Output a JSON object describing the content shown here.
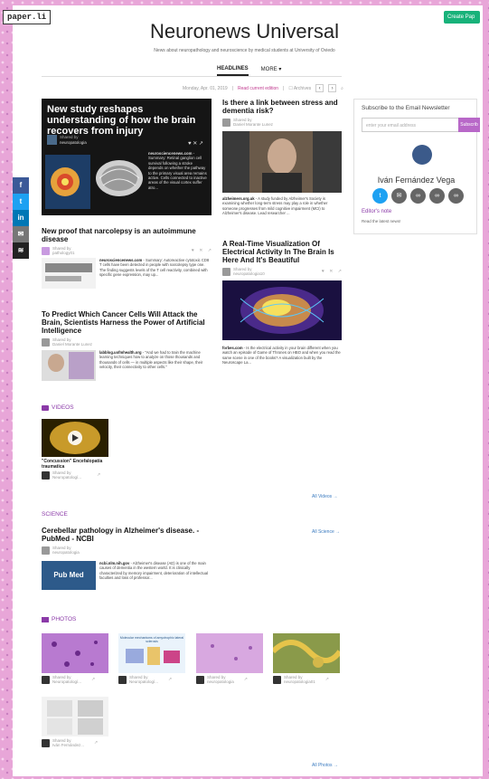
{
  "header": {
    "logo": "paper.li",
    "create_button": "Create Pap",
    "title": "Neuronews Universal",
    "subtitle": "News about neuropathology and neuroscience by medical students at University of Oviedo"
  },
  "nav": {
    "tabs": [
      "HEADLINES",
      "MORE ▾"
    ]
  },
  "datebar": {
    "date": "Monday, Apr. 01, 2019",
    "current": "Read current edition",
    "archives": "☐ Archives",
    "prev": "‹",
    "next": "›",
    "search": "⌕"
  },
  "share_icons": [
    "f",
    "t",
    "in",
    "✉",
    "≋"
  ],
  "share_colors": [
    "#3b5998",
    "#1da1f2",
    "#0077b5",
    "#777777",
    "#222222"
  ],
  "hero": {
    "title": "New study reshapes understanding of how the brain recovers from injury",
    "shared": "Shared by",
    "author": "neuropatologia",
    "excerpt_source": "neurosciencenews.com",
    "excerpt": "- Summary: Retinal ganglion cell survival following a stroke depends on whether the pathway to the primary visual area remains active. Cells connected to inactive areas of the visual cortex suffer atro..."
  },
  "a1": {
    "title": "Is there a link between stress and dementia risk?",
    "shared": "Shared by",
    "author": "Daniel Morante Lunez",
    "source": "alzheimers.org.uk",
    "excerpt": "- A study funded by Alzheimer's Society is examining whether long-term stress may play a role in whether someone progresses from mild cognitive impairment (MCI) to Alzheimer's disease. Lead researcher ..."
  },
  "a2": {
    "title": "New proof that narcolepsy is an autoimmune disease",
    "shared": "Shared by",
    "author": "pathology01",
    "source": "neurosciencenews.com",
    "excerpt": "- Summary: Autoreactive cytotoxic CD8 T cells have been detected in people with narcolepsy type one. The finding suggests levels of the T cell reactivity, combined with specific gene expression, may up..."
  },
  "a3": {
    "title": "A Real-Time Visualization Of Electrical Activity In The Brain Is Here And It's Beautiful",
    "shared": "Shared by",
    "author": "neuropatologia10",
    "source": "forbes.com",
    "excerpt": "- Is the electrical activity in your brain different when you watch an episode of Game of Thrones on HBO and when you read the same scene in one of the books? A visualization built by the Neuroscape La..."
  },
  "a4": {
    "title": "To Predict Which Cancer Cells Will Attack the Brain, Scientists Harness the Power of Artificial Intelligence",
    "shared": "Shared by",
    "author": "Daniel Morante Lunez",
    "source": "labblog.uofmhealth.org",
    "excerpt": "- \"And we had to train the machine learning techniques how to analyze on those thousands and thousands of cells — in multiple aspects like their shape, their velocity, their connectivity to other cells.\""
  },
  "sidebar": {
    "heading": "Subscribe to the Email Newsletter",
    "placeholder": "enter your email address",
    "button": "Subscrib",
    "name": "Iván Fernández Vega",
    "note_title": "Editor's note",
    "note": "Read the latest news!",
    "icon_colors": [
      "#1da1f2",
      "#666666",
      "#666666",
      "#666666",
      "#666666"
    ]
  },
  "videos": {
    "label": "VIDEOS",
    "item_title": "\"Concussion\" Encefalopatía traumatica",
    "shared": "Shared by",
    "author": "Neuropatologí...",
    "more": "All Videos →"
  },
  "science": {
    "label": "SCIENCE",
    "more": "All Science →",
    "title": "Cerebellar pathology in Alzheimer's disease. - PubMed - NCBI",
    "shared": "Shared by",
    "author": "neuropatologia",
    "source": "ncbi.nlm.nih.gov",
    "excerpt": "- Alzheimer's disease (AD) is one of the main causes of dementia in the western world. It is clinically characterized by memory impairment, deterioration of intellectual faculties and loss of professor...",
    "pubmed": "Pub Med"
  },
  "photos": {
    "label": "PHOTOS",
    "more": "All Photos →",
    "items": [
      {
        "shared": "Shared by",
        "author": "Neuropatologí..."
      },
      {
        "shared": "Shared by",
        "author": "Neuropatologí..."
      },
      {
        "shared": "Shared by",
        "author": "neuropatologia"
      },
      {
        "shared": "Shared by",
        "author": "neuropatologia01"
      },
      {
        "shared": "Shared by",
        "author": "Iván Fernández..."
      }
    ],
    "molecular_text": "Molecular mechanisms of amyotrophic lateral sclerosis"
  }
}
